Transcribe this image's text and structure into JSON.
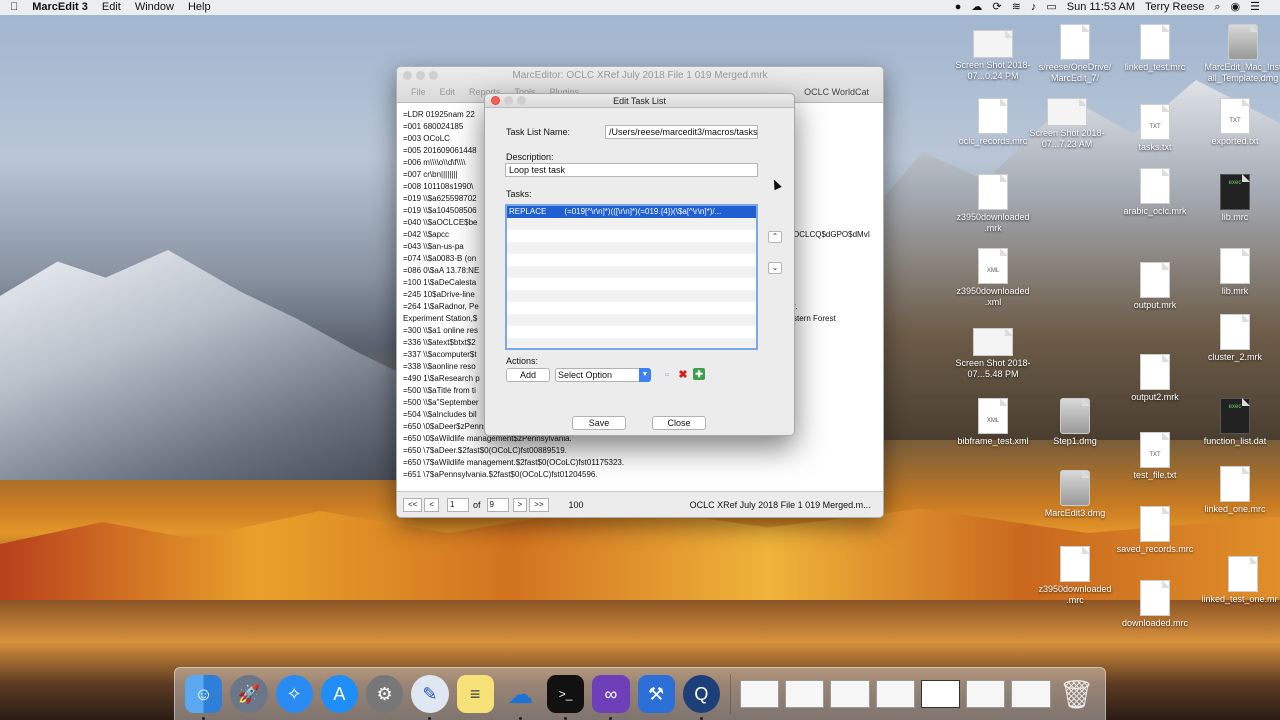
{
  "menubar": {
    "app": "MarcEdit 3",
    "items": [
      "Edit",
      "Window",
      "Help"
    ],
    "clock": "Sun 11:53 AM",
    "user": "Terry Reese"
  },
  "desktop_icons": [
    {
      "label": "Screen Shot 2018-07...0.24 PM",
      "kind": "shot"
    },
    {
      "label": "s/reese/OneDrive/ MarcEdit_7/",
      "kind": "doc"
    },
    {
      "label": "linked_test.mrc",
      "kind": "doc"
    },
    {
      "label": "MarcEdit_Mac_Inst all_Template.dmg",
      "kind": "drive"
    },
    {
      "label": "oclc_records.mrc",
      "kind": "doc"
    },
    {
      "label": "Screen Shot 2018-07...7.23 AM",
      "kind": "shot"
    },
    {
      "label": "tasks.txt",
      "kind": "txt"
    },
    {
      "label": "exported.txt",
      "kind": "txt"
    },
    {
      "label": "z3950downloaded .mrk",
      "kind": "doc"
    },
    {
      "label": "arabic_oclc.mrk",
      "kind": "doc"
    },
    {
      "label": "lib.mrc",
      "kind": "exec"
    },
    {
      "label": "z3950downloaded .xml",
      "kind": "xml"
    },
    {
      "label": "lib.mrk",
      "kind": "doc"
    },
    {
      "label": "output.mrk",
      "kind": "doc"
    },
    {
      "label": "cluster_2.mrk",
      "kind": "doc"
    },
    {
      "label": "Screen Shot 2018-07...5.48 PM",
      "kind": "shot"
    },
    {
      "label": "output2.mrk",
      "kind": "doc"
    },
    {
      "label": "bibframe_test.xml",
      "kind": "xml"
    },
    {
      "label": "Step1.dmg",
      "kind": "drive"
    },
    {
      "label": "function_list.dat",
      "kind": "exec"
    },
    {
      "label": "test_file.txt",
      "kind": "txt"
    },
    {
      "label": "MarcEdit3.dmg",
      "kind": "drive"
    },
    {
      "label": "linked_one.mrc",
      "kind": "doc"
    },
    {
      "label": "saved_records.mrc",
      "kind": "doc"
    },
    {
      "label": "z3950downloaded .mrc",
      "kind": "doc"
    },
    {
      "label": "linked_test_one.mr k",
      "kind": "doc"
    },
    {
      "label": "downloaded.mrc",
      "kind": "doc"
    }
  ],
  "editor": {
    "title": "MarcEditor: OCLC XRef July 2018 File 1 019 Merged.mrk",
    "toolbar": [
      "File",
      "Edit",
      "Reports",
      "Tools",
      "Plugins"
    ],
    "oclc": "OCLC WorldCat",
    "lines": [
      "=LDR  01925nam  22",
      "=001  680024185",
      "=003  OCoLC",
      "=005  201609061448",
      "=006  m\\\\\\\\o\\\\d\\f\\\\\\\\",
      "=007  cr\\bn||||||||",
      "=008  101108s1990\\",
      "=019  \\\\$a625598702",
      "=019  \\\\$a104508506",
      "=040  \\\\$aOCLCE$be",
      "=042  \\\\$apcc",
      "=043  \\\\$an-us-pa",
      "=074  \\\\$a0083-B (on",
      "=086  0\\$aA 13.78:NE",
      "=100  1\\$aDeCalesta",
      "=245  10$aDrive-line",
      "=264  1\\$aRadnor, Pe",
      "Experiment Station,$",
      "=300  \\\\$a1 online res",
      "=336  \\\\$atext$btxt$2",
      "=337  \\\\$acomputer$t",
      "=338  \\\\$aonline reso",
      "=490  1\\$aResearch p",
      "=500  \\\\$aTitle from ti",
      "=500  \\\\$a\"September",
      "=504  \\\\$aIncludes bil",
      "=650  \\0$aDeer$zPennsylvania.",
      "=650  \\0$aWildlife management$zPennsylvania.",
      "=650  \\7$aDeer.$2fast$0(OCoLC)fst00889519.",
      "=650  \\7$aWildlife management.$2fast$0(OCoLC)fst01175323.",
      "=651  \\7$aPennsylvania.$2fast$0(OCoLC)fst01204596."
    ],
    "right_fragments": {
      "r040": "OCLCQ$dGPO$dMvI",
      "r245": "r.",
      "r264": "stern Forest"
    },
    "status": {
      "first": "<<",
      "prev": "<",
      "page": "1",
      "of": "of",
      "total": "9",
      "next": ">",
      "last": ">>",
      "count": "100",
      "filename": "OCLC XRef July 2018 File 1 019 Merged.m..."
    }
  },
  "dialog": {
    "title": "Edit Task List",
    "task_list_name_label": "Task List Name:",
    "task_list_name_value": "/Users/reese/marcedit3/macros/tasksfile-20",
    "description_label": "Description:",
    "description_value": "Loop test task",
    "tasks_label": "Tasks:",
    "tasks": [
      {
        "type": "REPLACE",
        "detail": "(=019[^\\r\\n]*)(([\\r\\n]*)(=019.{4})(\\$a[^\\r\\n]*)/..."
      }
    ],
    "move_up": "⌃",
    "move_down": "⌄",
    "actions_label": "Actions:",
    "add_button": "Add",
    "select_option": "Select Option",
    "save_button": "Save",
    "close_button": "Close"
  }
}
